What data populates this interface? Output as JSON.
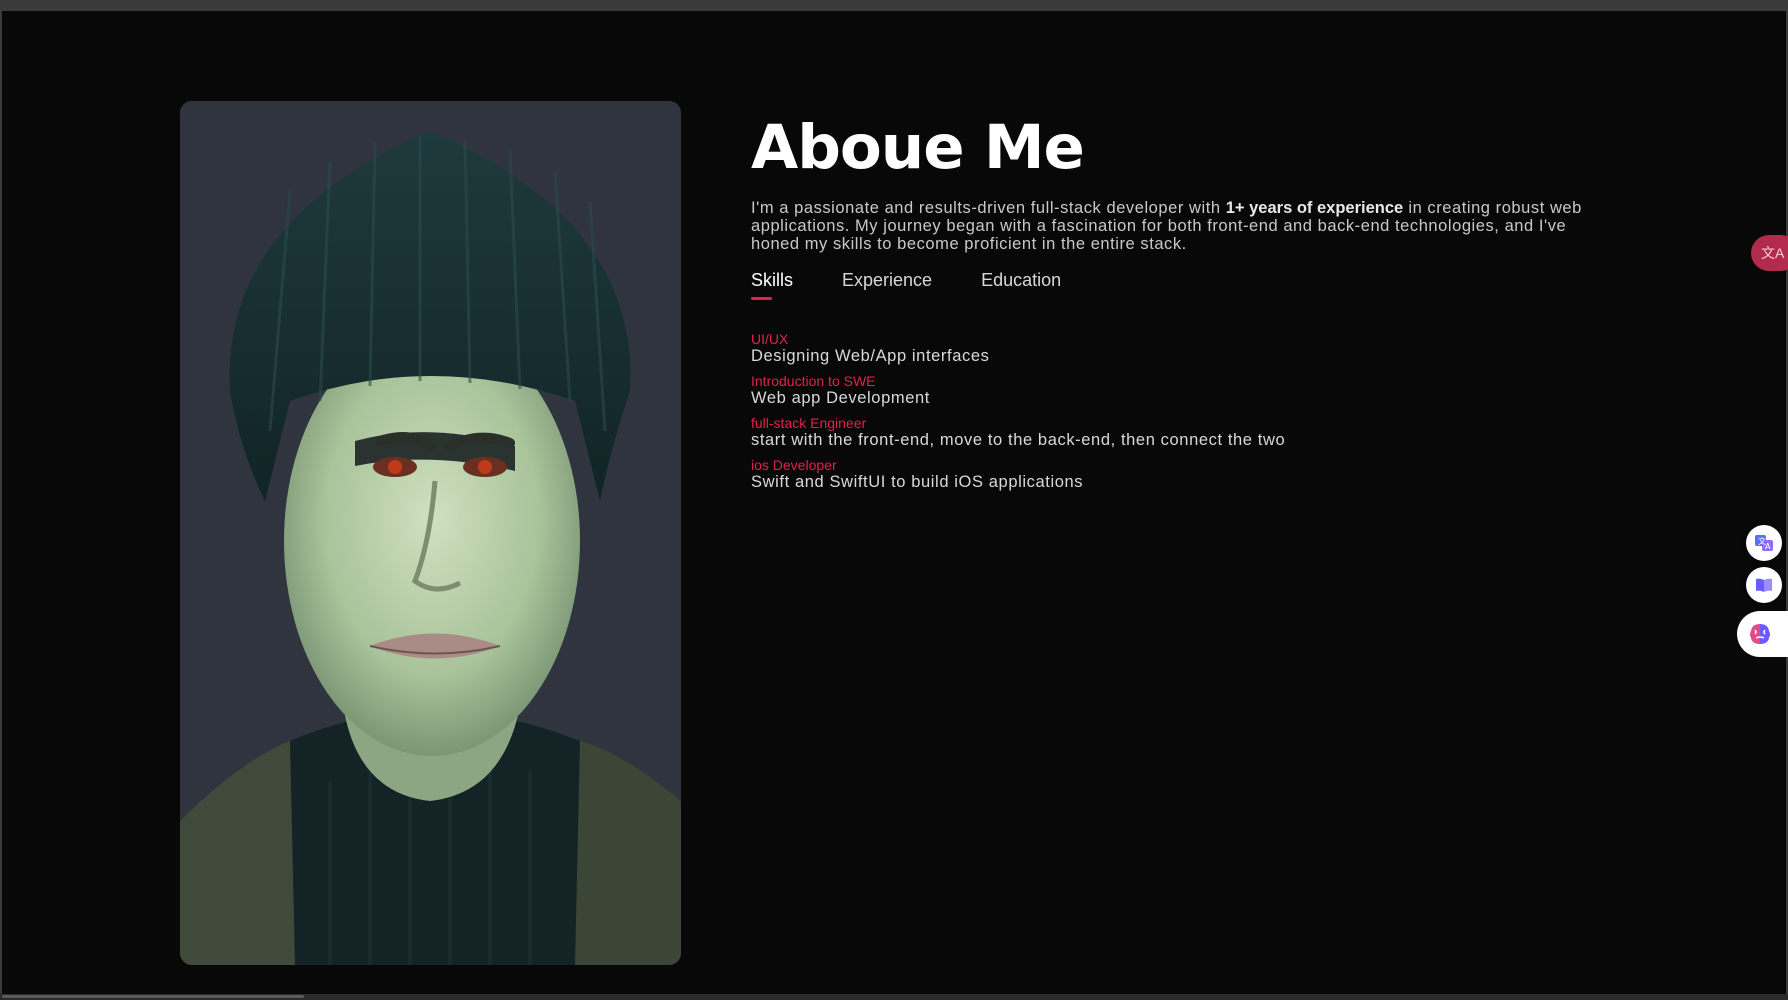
{
  "about": {
    "heading": "Aboue Me",
    "intro_before": "I'm a passionate and results-driven full-stack developer with ",
    "intro_bold": "1+ years of experience",
    "intro_after": " in creating robust web applications. My journey began with a fascination for both front-end and back-end technologies, and I've honed my skills to become proficient in the entire stack."
  },
  "tabs": [
    {
      "label": "Skills",
      "active": true
    },
    {
      "label": "Experience",
      "active": false
    },
    {
      "label": "Education",
      "active": false
    }
  ],
  "skills": [
    {
      "title": "UI/UX",
      "description": "Designing Web/App interfaces"
    },
    {
      "title": "Introduction to SWE",
      "description": "Web app Development"
    },
    {
      "title": "full-stack Engineer",
      "description": "start with the front-end, move to the back-end, then connect the two"
    },
    {
      "title": "ios Developer",
      "description": "Swift and SwiftUI to build iOS applications"
    }
  ],
  "colors": {
    "accent": "#e0224e",
    "background": "#080808",
    "photo_background": "#2f343f"
  },
  "floating_tools": {
    "translate_badge_icon": "translate-icon",
    "buttons": [
      "translate-icon",
      "reader-icon",
      "ai-brain-icon"
    ]
  }
}
